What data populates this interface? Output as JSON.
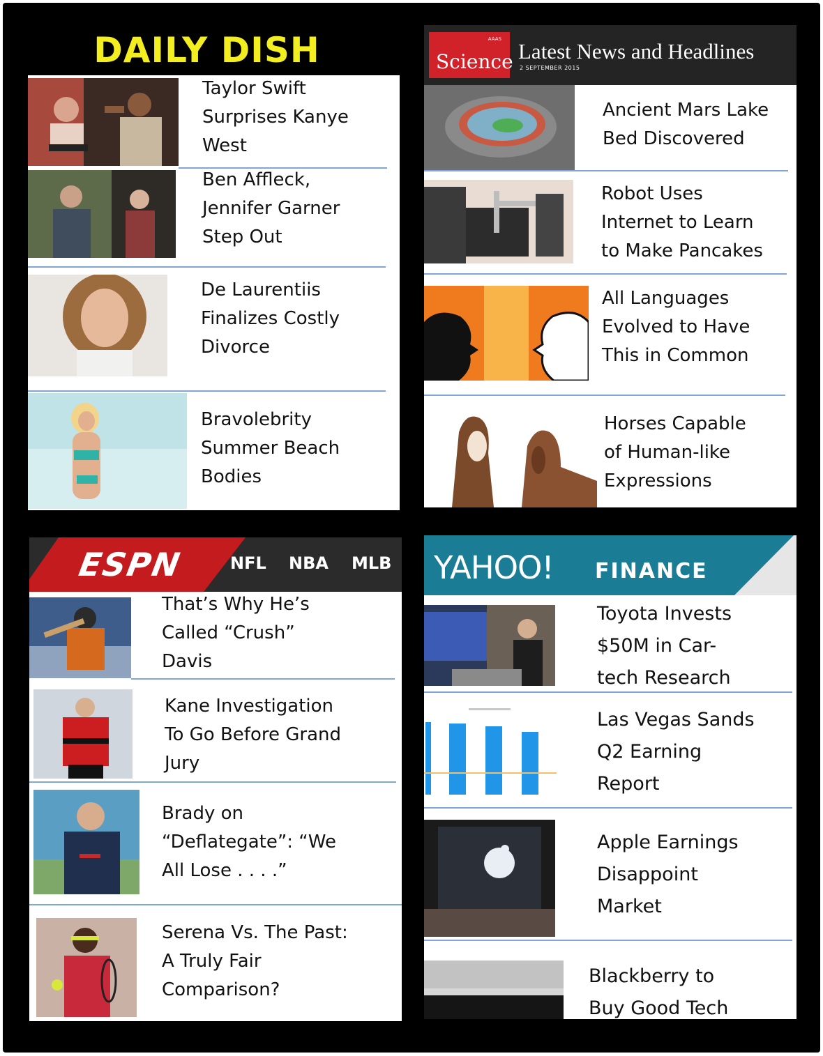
{
  "daily_dish": {
    "title": "DAILY DISH",
    "items": [
      {
        "headline": "Taylor Swift\nSurprises Kanye\nWest"
      },
      {
        "headline": "Ben Affleck,\nJennifer Garner\nStep Out"
      },
      {
        "headline": "De Laurentiis\nFinalizes Costly\nDivorce"
      },
      {
        "headline": "Bravolebrity\nSummer Beach\nBodies"
      }
    ]
  },
  "science": {
    "logo_small": "AAAS",
    "logo": "Science",
    "title": "Latest News and Headlines",
    "date": "2 SEPTEMBER 2015",
    "items": [
      {
        "headline": "Ancient Mars Lake\nBed Discovered"
      },
      {
        "headline": "Robot Uses\nInternet to Learn\nto Make Pancakes"
      },
      {
        "headline": "All Languages\nEvolved to Have\nThis in Common"
      },
      {
        "headline": "Horses Capable\nof  Human-like\nExpressions"
      }
    ]
  },
  "espn": {
    "logo": "ESPN",
    "nav": [
      "NFL",
      "NBA",
      "MLB"
    ],
    "items": [
      {
        "headline": "That’s Why He’s\nCalled “Crush”\nDavis"
      },
      {
        "headline": "Kane Investigation\nTo Go Before Grand\nJury"
      },
      {
        "headline": "Brady on\n“Deflategate”: “We\nAll Lose . . . .”"
      },
      {
        "headline": "Serena Vs. The Past:\nA Truly Fair\nComparison?"
      }
    ]
  },
  "yahoo": {
    "logo": "YAHOO!",
    "section": "FINANCE",
    "items": [
      {
        "headline": "Toyota Invests\n$50M in Car-\ntech Research"
      },
      {
        "headline": "Las Vegas Sands\nQ2 Earning\nReport"
      },
      {
        "headline": "Apple Earnings\nDisappoint\nMarket"
      },
      {
        "headline": "Blackberry to\nBuy Good Tech"
      }
    ]
  },
  "colors": {
    "divider": "#7fa6d4",
    "dish_title": "#f2ee1f",
    "science_red": "#d12129",
    "espn_red": "#c41b1e",
    "yahoo_teal": "#1b7d95"
  }
}
